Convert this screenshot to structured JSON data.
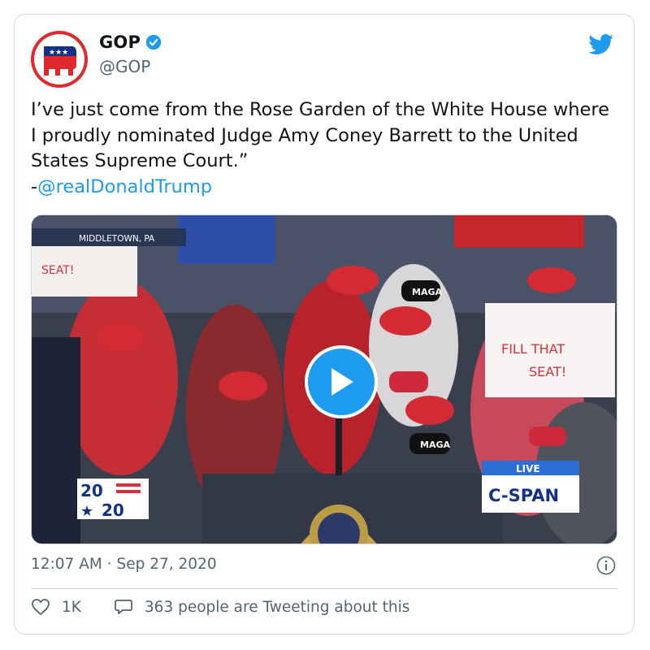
{
  "account": {
    "name": "GOP",
    "handle": "@GOP"
  },
  "tweet": {
    "text": "I’ve just come from the Rose Garden of the White House where I proudly nominated Judge Amy Coney Barrett to the United States Supreme Court.”",
    "attribution_prefix": "-",
    "mention": "@realDonaldTrump"
  },
  "media": {
    "location_caption": "MIDDLETOWN, PA",
    "sign_text": [
      "FILL THAT",
      "SEAT!"
    ],
    "mask_text": "MAGA",
    "live_label": "LIVE",
    "network_label": "C-SPAN",
    "election_logo": [
      "20",
      "20"
    ]
  },
  "meta": {
    "timestamp": "12:07 AM · Sep 27, 2020"
  },
  "actions": {
    "likes": "1K",
    "replies": "363 people are Tweeting about this"
  },
  "colors": {
    "accent": "#1d9bf0",
    "gop_red": "#e0292d",
    "text_secondary": "#536471"
  },
  "icons": {
    "avatar": "gop-elephant-icon",
    "verified": "verified-badge-icon",
    "brand": "twitter-bird-icon",
    "play": "play-icon",
    "info": "info-icon",
    "like": "heart-icon",
    "reply": "speech-bubble-icon"
  }
}
